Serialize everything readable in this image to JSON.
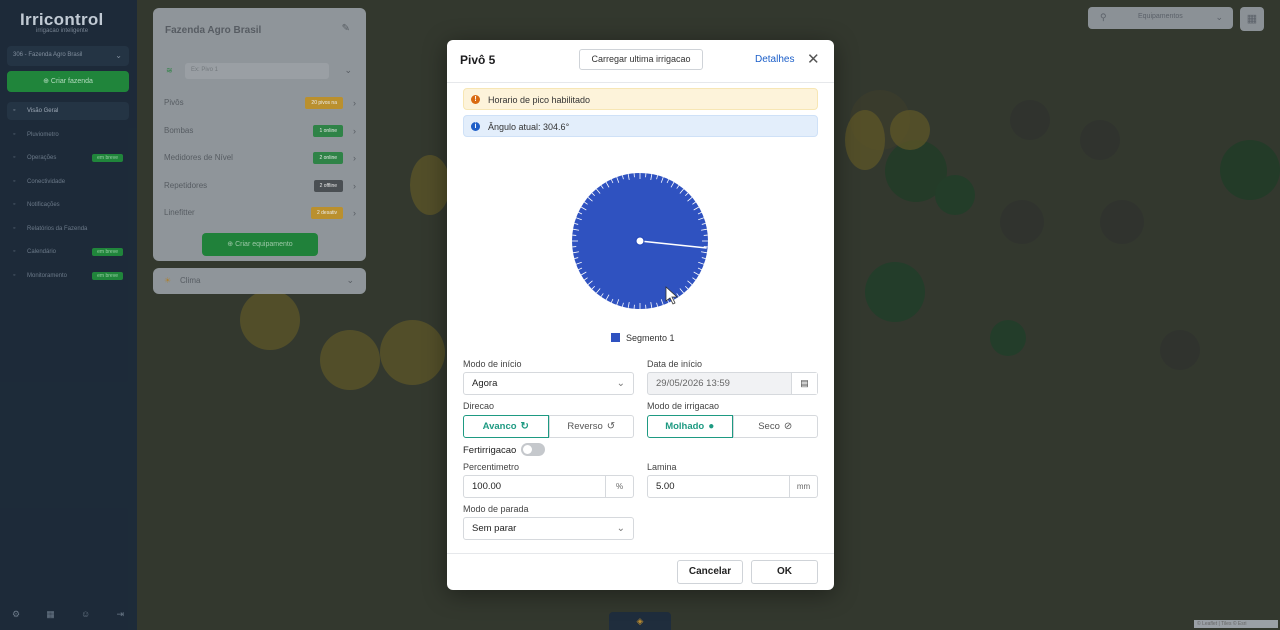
{
  "app": {
    "logo": "Irricontrol",
    "logo_sub": "irrigacao inteligente",
    "farm_select": "306 - Fazenda Agro Brasil",
    "new_farm_button": "Criar fazenda",
    "nav": [
      {
        "label": "Visão Geral",
        "icon": "map-icon",
        "badge": ""
      },
      {
        "label": "Pluviometro",
        "icon": "rain-icon",
        "badge": ""
      },
      {
        "label": "Operações",
        "icon": "chart-icon",
        "badge": "em breve"
      },
      {
        "label": "Conectividade",
        "icon": "wifi-icon",
        "badge": ""
      },
      {
        "label": "Notificações",
        "icon": "bell-icon",
        "badge": ""
      },
      {
        "label": "Relatórios da Fazenda",
        "icon": "report-icon",
        "badge": ""
      },
      {
        "label": "Calendário",
        "icon": "calendar-icon",
        "badge": "em breve"
      },
      {
        "label": "Monitoramento",
        "icon": "monitor-icon",
        "badge": "em breve"
      }
    ]
  },
  "farm_panel": {
    "title": "Fazenda Agro Brasil",
    "search_placeholder": "Ex: Pivo 1",
    "rows": [
      {
        "label": "Pivôs",
        "tag": "20 pivos na",
        "tag_color": "#c99a2e"
      },
      {
        "label": "Bombas",
        "tag": "1 online",
        "tag_color": "#2f8c4a"
      },
      {
        "label": "Medidores de Nível",
        "tag": "2 online",
        "tag_color": "#2f8c4a"
      },
      {
        "label": "Repetidores",
        "tag": "2 offline",
        "tag_color": "#4d5258"
      },
      {
        "label": "Linefitter",
        "tag": "2 desativ",
        "tag_color": "#c99a2e"
      }
    ],
    "create_button": "Criar equipamento",
    "climate_label": "Clima"
  },
  "map": {
    "equipment_select": "Equipamentos",
    "attribution": "© Leaflet | Tiles © Esri"
  },
  "modal": {
    "title": "Pivô 5",
    "load_last_button": "Carregar ultima irrigacao",
    "details_link": "Detalhes",
    "alert_warning": "Horario de pico habilitado",
    "alert_info": "Ângulo atual: 304.6°",
    "current_angle_deg": 304.6,
    "segment_color": "#2f52c0",
    "legend": "Segmento 1",
    "start_mode_label": "Modo de início",
    "start_mode_value": "Agora",
    "start_date_label": "Data de início",
    "start_date_value": "29/05/2026 13:59",
    "direction_label": "Direcao",
    "direction_options": [
      "Avanco",
      "Reverso"
    ],
    "irrigation_mode_label": "Modo de irrigacao",
    "irrigation_options": [
      "Molhado",
      "Seco"
    ],
    "fertirrigation_label": "Fertirrigacao",
    "percent_label": "Percentimetro",
    "percent_value": "100.00",
    "percent_unit": "%",
    "lamina_label": "Lamina",
    "lamina_value": "5.00",
    "lamina_unit": "mm",
    "stop_mode_label": "Modo de parada",
    "stop_mode_value": "Sem parar",
    "cancel_button": "Cancelar",
    "ok_button": "OK"
  }
}
